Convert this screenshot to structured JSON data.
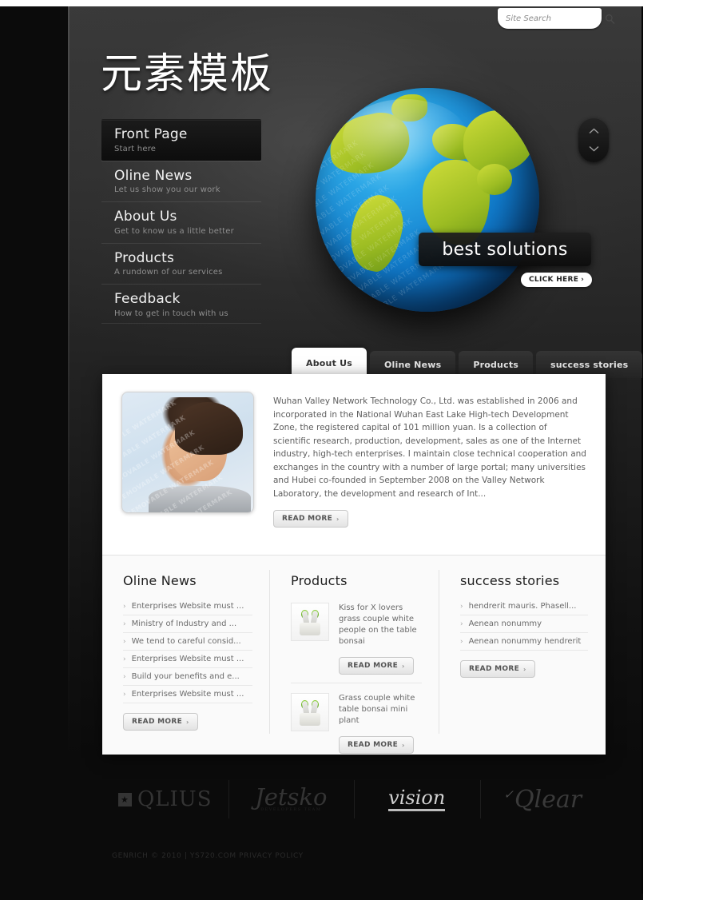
{
  "site": {
    "logo_text": "元素模板",
    "copyright": "GENRICH © 2010 | YS720.COM PRIVACY POLICY"
  },
  "search": {
    "placeholder": "Site Search",
    "value": "",
    "icon": "search-icon"
  },
  "nav": {
    "items": [
      {
        "title": "Front Page",
        "subtitle": "Start here",
        "active": true
      },
      {
        "title": "Oline News",
        "subtitle": "Let us show you our work",
        "active": false
      },
      {
        "title": "About Us",
        "subtitle": "Get to know us a little better",
        "active": false
      },
      {
        "title": "Products",
        "subtitle": "A rundown of our services",
        "active": false
      },
      {
        "title": "Feedback",
        "subtitle": "How to get in touch with us",
        "active": false
      }
    ]
  },
  "hero": {
    "caption": "best solutions",
    "cta_label": "CLICK HERE",
    "cta_chevron": "›",
    "watermark": "REMOVABLE WATERMARK",
    "slider_up_icon": "chevron-up-icon",
    "slider_down_icon": "chevron-down-icon",
    "colors": {
      "ocean": "#1a8fd8",
      "land": "#b8cc2e",
      "ocean_deep": "#0a4f96"
    }
  },
  "tabs": [
    {
      "label": "About Us",
      "active": true
    },
    {
      "label": "Oline News",
      "active": false
    },
    {
      "label": "Products",
      "active": false
    },
    {
      "label": "success stories",
      "active": false
    }
  ],
  "about": {
    "image_watermark": "REMOVABLE WATERMARK",
    "text": "Wuhan Valley Network Technology Co., Ltd. was established in 2006 and incorporated in the National Wuhan East Lake High-tech Development Zone, the registered capital of 101 million yuan. Is a collection of scientific research, production, development, sales as one of the Internet industry, high-tech enterprises.   I maintain close technical cooperation and exchanges in the country with a number of large portal; many universities and Hubei co-founded in September 2008 on the Valley Network Laboratory, the development and research of Int...",
    "read_more": "READ MORE",
    "chevron": "›"
  },
  "columns": {
    "news": {
      "title": "Oline News",
      "bullet": "›",
      "items": [
        "Enterprises Website must ...",
        "Ministry of Industry and ...",
        "We tend to careful consid...",
        "Enterprises Website must ...",
        "Build your benefits and e...",
        "Enterprises Website must ..."
      ],
      "read_more": "READ MORE"
    },
    "products": {
      "title": "Products",
      "items": [
        {
          "text": "Kiss for X lovers grass couple white people on the table bonsai",
          "read_more": "READ MORE",
          "thumb": "bonsai-figurine-icon"
        },
        {
          "text": "Grass couple white table bonsai mini plant",
          "read_more": "READ MORE",
          "thumb": "bonsai-figurine-icon"
        }
      ]
    },
    "stories": {
      "title": "success stories",
      "bullet": "›",
      "items": [
        "hendrerit mauris. Phasell...",
        "Aenean nonummy",
        "Aenean nonummy hendrerit"
      ],
      "read_more": "READ MORE"
    }
  },
  "partners": [
    {
      "name": "QLIUS",
      "star": "★"
    },
    {
      "name": "Jetsko",
      "sub": "DEVELOPERS TEAM"
    },
    {
      "name": "vision"
    },
    {
      "name": "Qlear",
      "tick": "✓"
    }
  ]
}
